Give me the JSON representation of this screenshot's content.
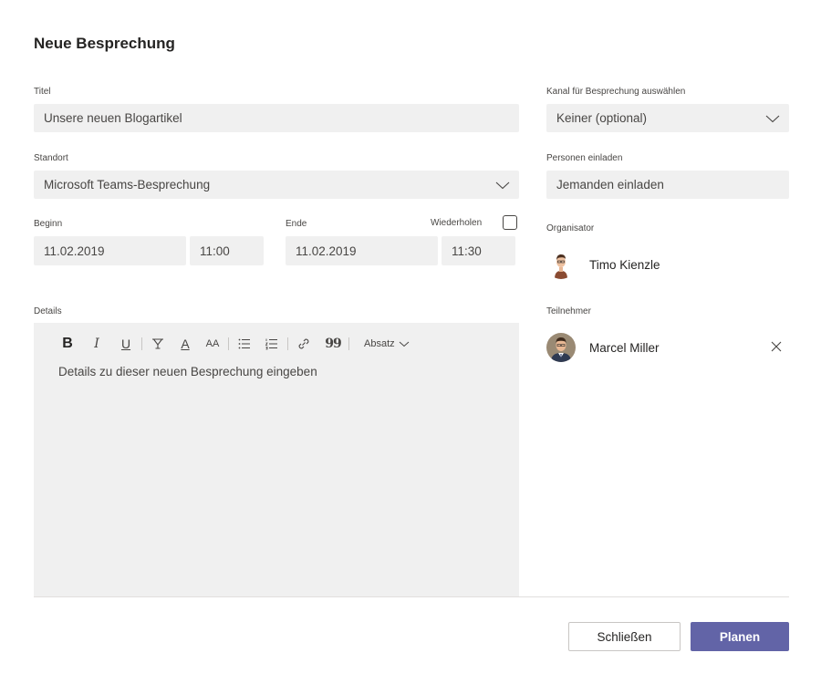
{
  "dialog": {
    "title": "Neue Besprechung"
  },
  "form": {
    "title_label": "Titel",
    "title_value": "Unsere neuen Blogartikel",
    "location_label": "Standort",
    "location_value": "Microsoft Teams-Besprechung",
    "start_label": "Beginn",
    "start_date": "11.02.2019",
    "start_time": "11:00",
    "end_label": "Ende",
    "end_date": "11.02.2019",
    "end_time": "11:30",
    "repeat_label": "Wiederholen",
    "repeat_checked": false,
    "details_label": "Details",
    "details_placeholder": "Details zu dieser neuen Besprechung eingeben"
  },
  "toolbar": {
    "bold": "B",
    "italic": "I",
    "underline": "U",
    "font_color": "A",
    "font_size": "AA",
    "quote": "99",
    "paragraph_label": "Absatz"
  },
  "sidebar": {
    "channel_label": "Kanal für Besprechung auswählen",
    "channel_value": "Keiner (optional)",
    "invite_label": "Personen einladen",
    "invite_placeholder": "Jemanden einladen",
    "organizer_label": "Organisator",
    "organizer_name": "Timo Kienzle",
    "participants_label": "Teilnehmer",
    "participants": [
      {
        "name": "Marcel Miller"
      }
    ]
  },
  "footer": {
    "close_label": "Schließen",
    "schedule_label": "Planen"
  },
  "colors": {
    "accent": "#6264a7",
    "field_bg": "#f0f0f0",
    "text": "#252423",
    "muted_text": "#484644"
  }
}
